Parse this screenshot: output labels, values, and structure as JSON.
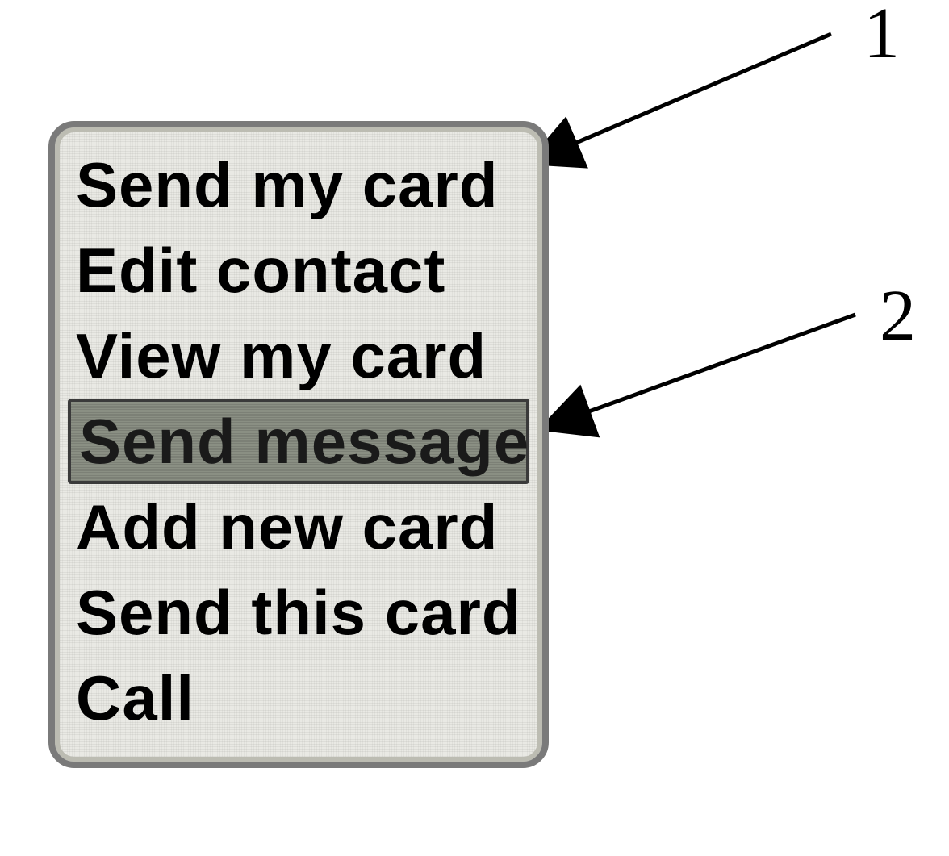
{
  "menu": {
    "items": [
      {
        "label": "Send my card",
        "selected": false
      },
      {
        "label": "Edit contact",
        "selected": false
      },
      {
        "label": "View my card",
        "selected": false
      },
      {
        "label": "Send message",
        "selected": true
      },
      {
        "label": "Add new card",
        "selected": false
      },
      {
        "label": "Send this card",
        "selected": false
      },
      {
        "label": "Call",
        "selected": false
      }
    ]
  },
  "callouts": [
    {
      "label": "1"
    },
    {
      "label": "2"
    }
  ]
}
